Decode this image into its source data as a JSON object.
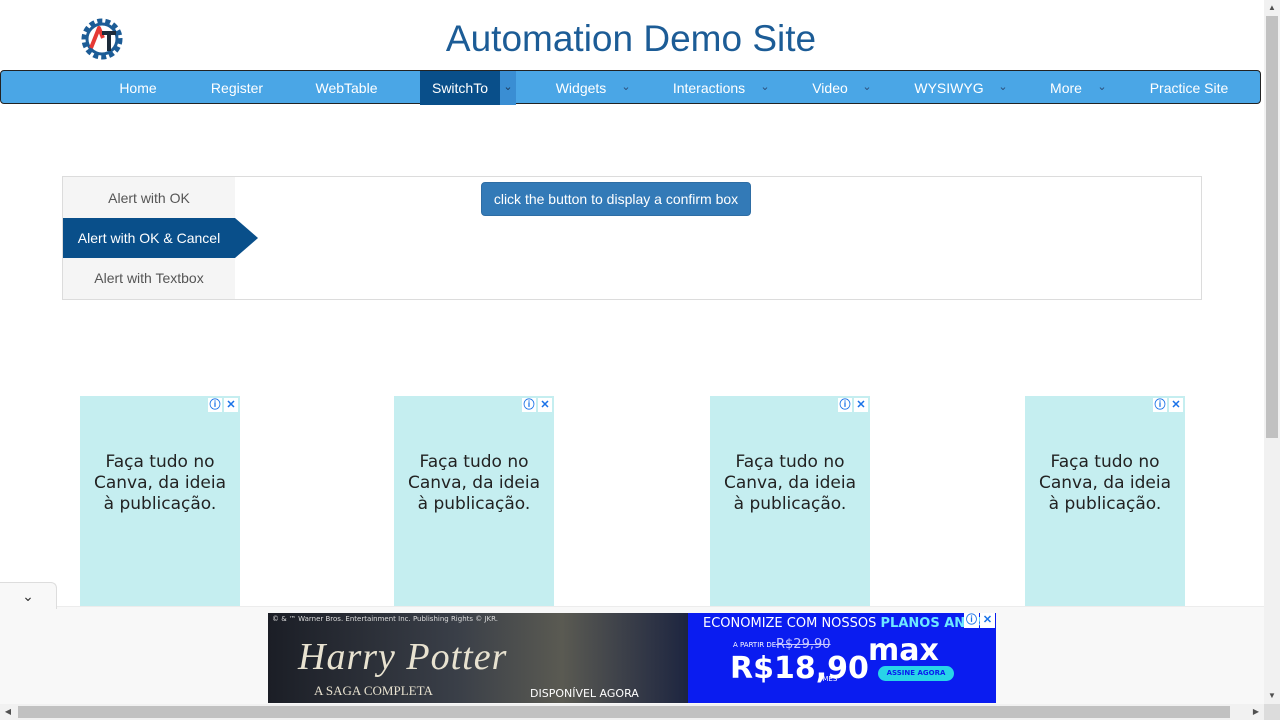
{
  "header": {
    "title": "Automation Demo Site",
    "logo_icon": "automation-testing-gear-logo"
  },
  "nav": {
    "items": [
      "Home",
      "Register",
      "WebTable",
      "SwitchTo",
      "Widgets",
      "Interactions",
      "Video",
      "WYSIWYG",
      "More",
      "Practice Site"
    ],
    "active": "SwitchTo",
    "dropdown_icon": "chevron-down-icon"
  },
  "alerts": {
    "tabs": [
      "Alert with OK",
      "Alert with OK & Cancel",
      "Alert with Textbox"
    ],
    "active_tab": "Alert with OK & Cancel",
    "button_label": "click the button to display a confirm box"
  },
  "ads": {
    "text_line1": "Faça tudo no",
    "text_line2": "Canva, da ideia",
    "text_line3": "à publicação.",
    "info_icon": "ⓘ",
    "close_icon": "✕"
  },
  "banner": {
    "copyright": "© & ™ Warner Bros. Entertainment Inc. Publishing Rights © JKR.",
    "brand": "Harry Potter",
    "subtitle": "A SAGA COMPLETA",
    "available": "DISPONÍVEL AGORA",
    "promo_prefix": "ECONOMIZE COM NOSSOS ",
    "promo_highlight": "PLANOS ANUA",
    "price_prefix": "A PARTIR DE",
    "old_price": "R$29,90",
    "price": "R$18,90",
    "per_month": "/MÊS",
    "service": "max",
    "cta": "ASSINE AGORA"
  },
  "anchor": {
    "toggle_icon": "chevron-down-icon"
  },
  "colors": {
    "nav_bg": "#4aa6e6",
    "nav_active": "#094f8a",
    "title": "#1c5c96",
    "button": "#337ab7",
    "ad_bg": "#c5eef0",
    "banner_bg": "#0a1cf0"
  }
}
